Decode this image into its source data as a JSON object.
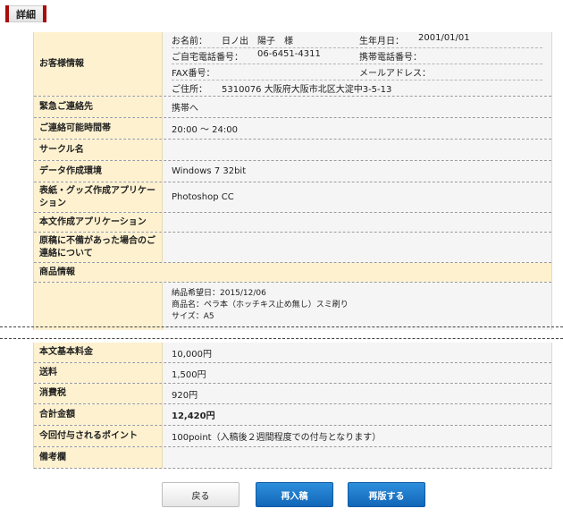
{
  "section_title": "詳細",
  "customer": {
    "label": "お客様情報",
    "name_label": "お名前：",
    "name_value": "日ノ出　陽子　様",
    "birth_label": "生年月日：",
    "birth_value": "2001/01/01",
    "home_phone_label": "ご自宅電話番号：",
    "home_phone_value": "06-6451-4311",
    "mobile_label": "携帯電話番号：",
    "mobile_value": "",
    "fax_label": "FAX番号：",
    "fax_value": "",
    "email_label": "メールアドレス：",
    "email_value": "",
    "address_label": "ご住所：",
    "address_value": "5310076 大阪府大阪市北区大淀中3-5-13"
  },
  "rows1": [
    {
      "label": "緊急ご連絡先",
      "value": "携帯へ"
    },
    {
      "label": "ご連絡可能時間帯",
      "value": "20:00 ～ 24:00"
    },
    {
      "label": "サークル名",
      "value": ""
    },
    {
      "label": "データ作成環境",
      "value": "Windows 7 32bit"
    },
    {
      "label": "表紙・グッズ作成アプリケーション",
      "value": "Photoshop CC"
    },
    {
      "label": "本文作成アプリケーション",
      "value": ""
    },
    {
      "label": "原稿に不備があった場合のご連絡について",
      "value": ""
    }
  ],
  "product": {
    "label": "商品情報",
    "lines": [
      "納品希望日：2015/12/06",
      "商品名：ペラ本（ホッチキス止め無し）スミ刷り",
      "サイズ：A5"
    ]
  },
  "rows2": [
    {
      "label": "本文基本料金",
      "value": "10,000円"
    },
    {
      "label": "送料",
      "value": "1,500円"
    },
    {
      "label": "消費税",
      "value": "920円"
    },
    {
      "label": "合計金額",
      "value": "12,420円"
    },
    {
      "label": "今回付与されるポイント",
      "value": "100point（入稿後２週間程度での付与となります）"
    },
    {
      "label": "備考欄",
      "value": ""
    }
  ],
  "buttons": {
    "back": "戻る",
    "resubmit": "再入稿",
    "reprint": "再版する"
  },
  "colors": {
    "label_bg": "#fdf1cf",
    "value_bg": "#f5f5f5",
    "accent_red": "#a80c0c",
    "button_blue": "#1a76c8"
  }
}
